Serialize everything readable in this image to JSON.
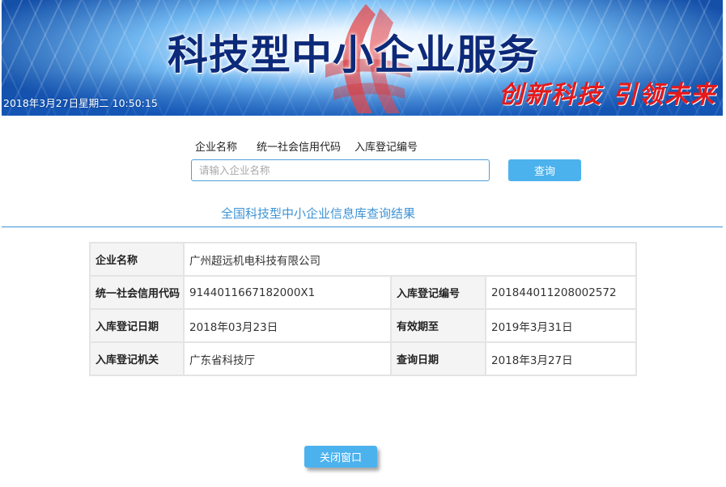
{
  "banner": {
    "title": "科技型中小企业服务",
    "datetime": "2018年3月27日星期二 10:50:15",
    "slogan": "创新科技 引领未来",
    "title_color": "#0d2a7a",
    "slogan_color": "#e6191b",
    "logo_icon": "sme-logo-icon"
  },
  "search": {
    "tabs": [
      "企业名称",
      "统一社会信用代码",
      "入库登记编号"
    ],
    "placeholder": "请输入企业名称",
    "value": "",
    "button_label": "查询",
    "accent_color": "#4cb2ee"
  },
  "results": {
    "title": "全国科技型中小企业信息库查询结果",
    "company_name_label": "企业名称",
    "company_name": "广州超远机电科技有限公司",
    "credit_code_label": "统一社会信用代码",
    "credit_code": "9144011667182000X1",
    "registration_no_label": "入库登记编号",
    "registration_no": "201844011208002572",
    "registration_date_label": "入库登记日期",
    "registration_date": "2018年03月23日",
    "valid_until_label": "有效期至",
    "valid_until": "2019年3月31日",
    "registration_authority_label": "入库登记机关",
    "registration_authority": "广东省科技厅",
    "query_date_label": "查询日期",
    "query_date": "2018年3月27日"
  },
  "footer": {
    "close_label": "关闭窗口"
  }
}
